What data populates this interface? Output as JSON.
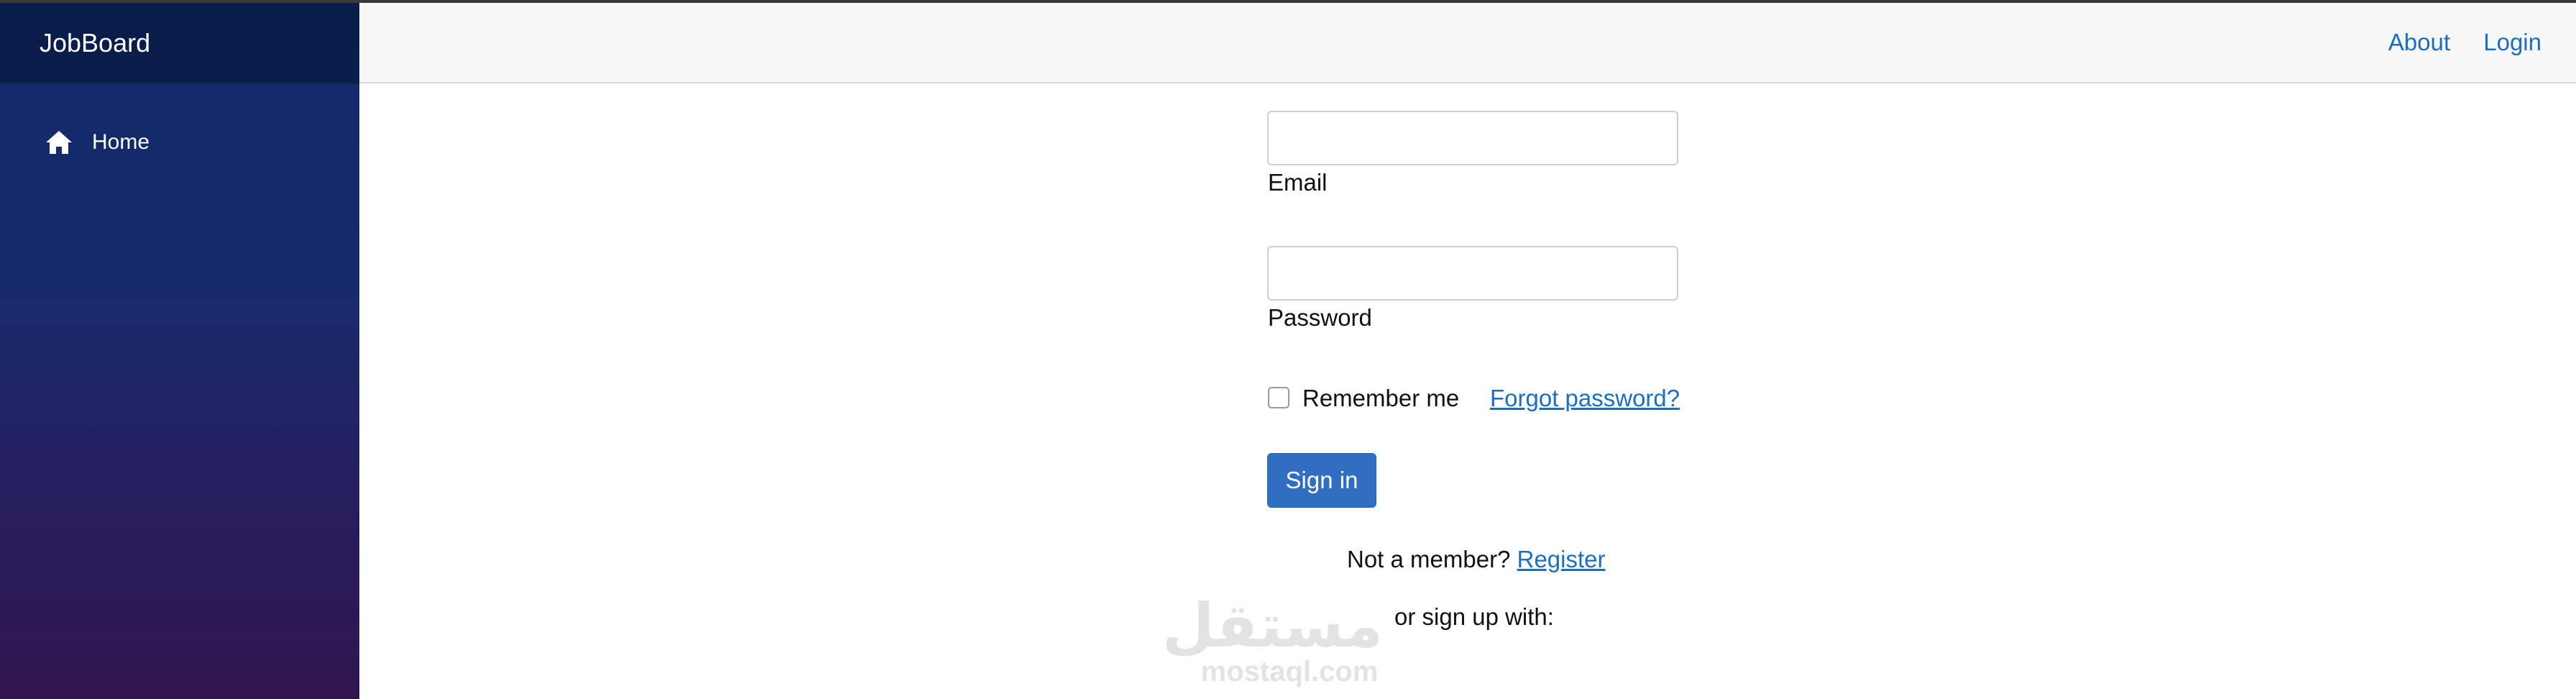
{
  "sidebar": {
    "brand": "JobBoard",
    "items": [
      {
        "label": "Home",
        "icon": "home-icon"
      }
    ],
    "colors": {
      "top": "#0e2a6b",
      "bottom": "#311650"
    }
  },
  "topbar": {
    "about_label": "About",
    "login_label": "Login"
  },
  "form": {
    "email": {
      "label": "Email",
      "value": ""
    },
    "password": {
      "label": "Password",
      "value": ""
    },
    "remember_label": "Remember me",
    "remember_checked": false,
    "forgot_label": "Forgot password?",
    "signin_label": "Sign in",
    "member_prompt": "Not a member?",
    "register_label": "Register",
    "signup_with": "or sign up with:"
  },
  "watermark": {
    "arabic": "مستقل",
    "latin": "mostaql.com"
  },
  "colors": {
    "link": "#1b6ec2",
    "primary_button": "#2f6ec0",
    "topbar_bg": "#f7f7f7"
  }
}
